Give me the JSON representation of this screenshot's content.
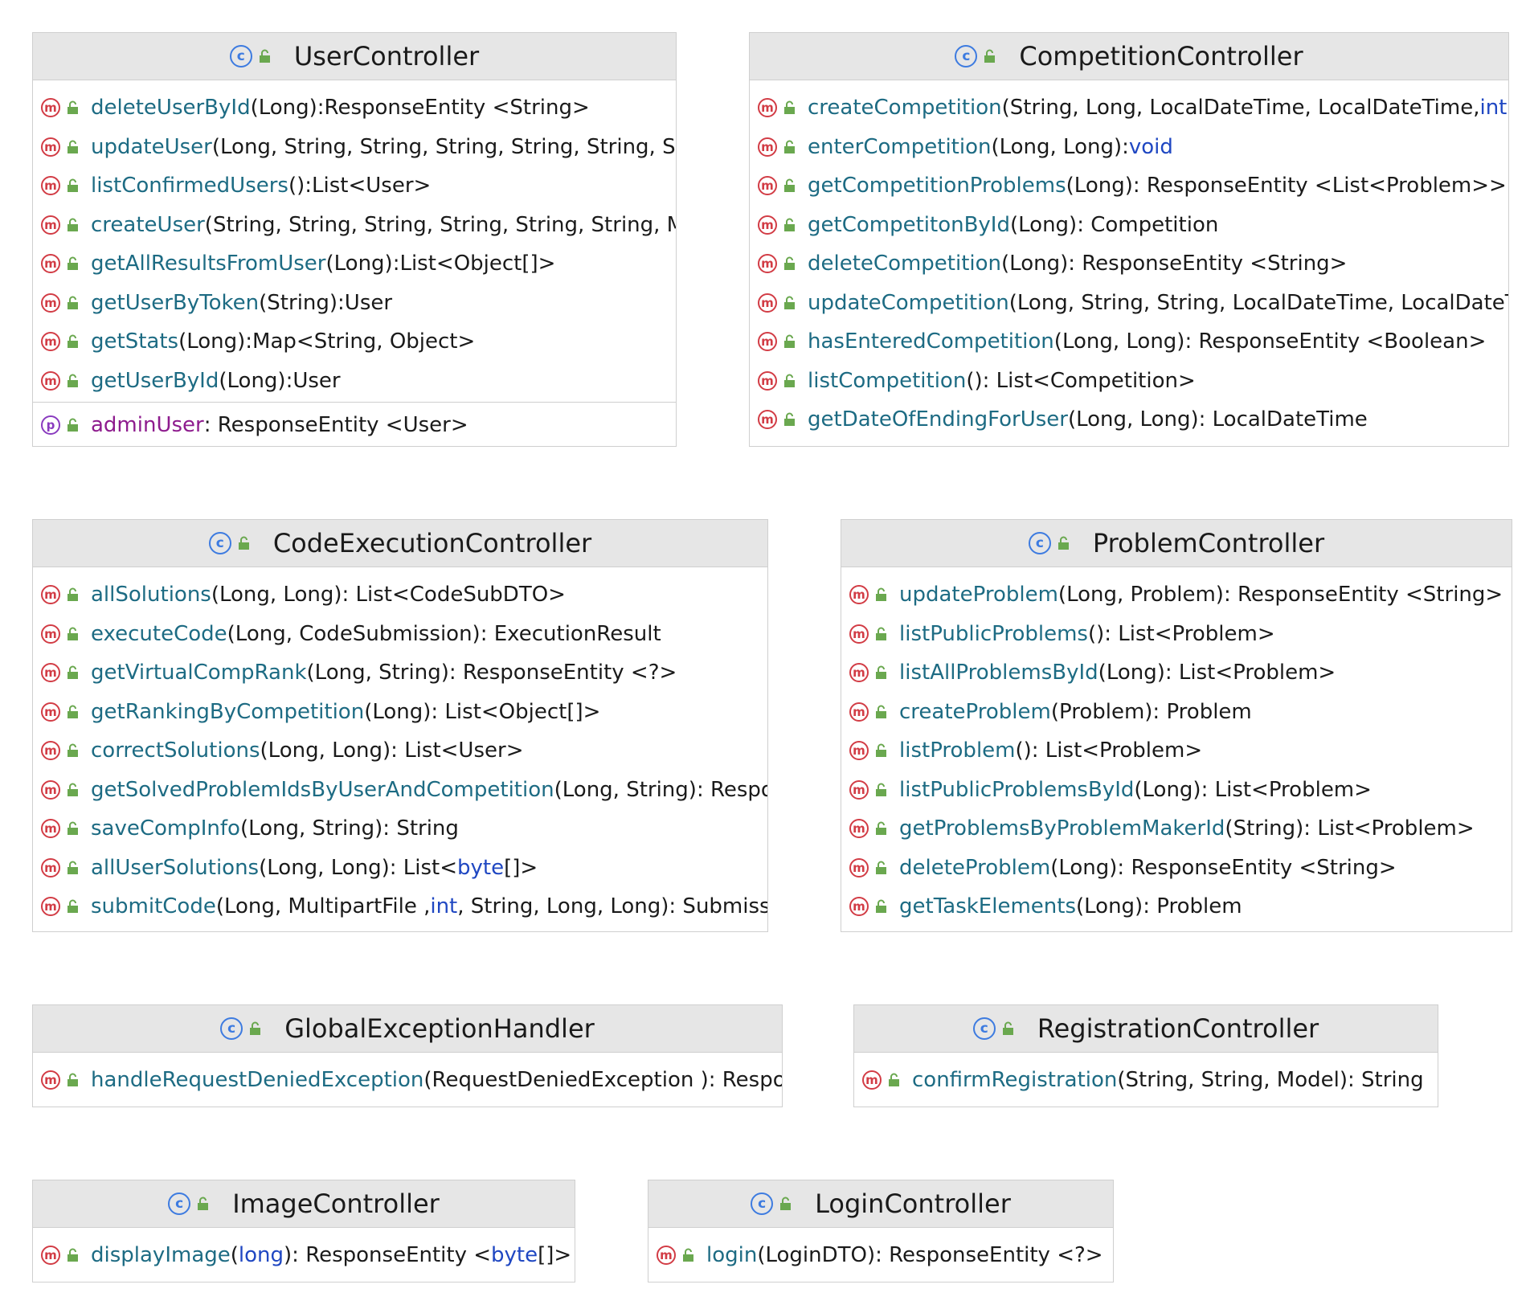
{
  "classes": {
    "user": {
      "name": "UserController",
      "methods": [
        {
          "name": "deleteUserById",
          "params": " (Long):  ",
          "ret": "ResponseEntity <String>"
        },
        {
          "name": "updateUser",
          "params": " (Long, String, String, String, String, String, String",
          "ret": ""
        },
        {
          "name": "listConfirmedUsers",
          "params": " ():  ",
          "ret": "List<User>"
        },
        {
          "name": "createUser",
          "params": " (String, String, String, String, String, String, M",
          "ret": ""
        },
        {
          "name": "getAllResultsFromUser",
          "params": " (Long):  ",
          "ret": "List<Object[]>"
        },
        {
          "name": "getUserByToken",
          "params": " (String):  ",
          "ret": "User"
        },
        {
          "name": "getStats",
          "params": " (Long):  ",
          "ret": "Map<String, Object>"
        },
        {
          "name": "getUserById",
          "params": " (Long):  ",
          "ret": "User"
        }
      ],
      "property": {
        "name": "adminUser",
        "ret": ":  ResponseEntity <User>"
      }
    },
    "competition": {
      "name": "CompetitionController",
      "methods": [
        {
          "name": "createCompetition",
          "params": " (String, Long, LocalDateTime, LocalDateTime, ",
          "kw": "int",
          "tail": ","
        },
        {
          "name": "enterCompetition",
          "params": " (Long, Long):  ",
          "kw": "void",
          "tail": ""
        },
        {
          "name": "getCompetitionProblems",
          "params": " (Long):  ResponseEntity <List<Problem>>",
          "kw": "",
          "tail": ""
        },
        {
          "name": "getCompetitonById",
          "params": " (Long):  Competition",
          "kw": "",
          "tail": ""
        },
        {
          "name": "deleteCompetition",
          "params": " (Long):  ResponseEntity <String>",
          "kw": "",
          "tail": ""
        },
        {
          "name": "updateCompetition",
          "params": " (Long, String, String, LocalDateTime, LocalDateTi",
          "kw": "",
          "tail": ""
        },
        {
          "name": "hasEnteredCompetition",
          "params": " (Long, Long):  ResponseEntity <Boolean>",
          "kw": "",
          "tail": ""
        },
        {
          "name": "listCompetition",
          "params": " ():  List<Competition>",
          "kw": "",
          "tail": ""
        },
        {
          "name": "getDateOfEndingForUser",
          "params": " (Long, Long):  LocalDateTime",
          "kw": "",
          "tail": ""
        }
      ]
    },
    "codeexec": {
      "name": "CodeExecutionController",
      "methods": [
        {
          "name": "allSolutions",
          "params": "(Long, Long):  List<CodeSubDTO>",
          "kw": "",
          "tail": ""
        },
        {
          "name": "executeCode",
          "params": " (Long, CodeSubmission):  ExecutionResult",
          "kw": "",
          "tail": ""
        },
        {
          "name": "getVirtualCompRank",
          "params": "(Long, String):  ResponseEntity <?>",
          "kw": "",
          "tail": ""
        },
        {
          "name": "getRankingByCompetition",
          "params": " (Long):  List<Object[]>",
          "kw": "",
          "tail": ""
        },
        {
          "name": "correctSolutions",
          "params": " (Long, Long):  List<User>",
          "kw": "",
          "tail": ""
        },
        {
          "name": "getSolvedProblemIdsByUserAndCompetition",
          "params": " (Long, String):  Respo",
          "kw": "",
          "tail": ""
        },
        {
          "name": "saveCompInfo",
          "params": "(Long, String):  String",
          "kw": "",
          "tail": ""
        },
        {
          "name": "allUserSolutions",
          "params": " (Long, Long):  List<",
          "kw": "byte",
          "tail": "[]>"
        },
        {
          "name": "submitCode",
          "params": "(Long, MultipartFile , ",
          "kw": "int",
          "tail": ", String, Long, Long):  Submiss"
        }
      ]
    },
    "problem": {
      "name": "ProblemController",
      "methods": [
        {
          "name": "updateProblem",
          "params": "(Long, Problem):  ResponseEntity <String>"
        },
        {
          "name": "listPublicProblems",
          "params": "():  List<Problem>"
        },
        {
          "name": "listAllProblemsById",
          "params": "(Long):  List<Problem>"
        },
        {
          "name": "createProblem",
          "params": "(Problem):  Problem"
        },
        {
          "name": "listProblem",
          "params": "():  List<Problem>"
        },
        {
          "name": "listPublicProblemsById",
          "params": "(Long):  List<Problem>"
        },
        {
          "name": "getProblemsByProblemMakerId",
          "params": "(String):  List<Problem>"
        },
        {
          "name": "deleteProblem",
          "params": " (Long):  ResponseEntity <String>"
        },
        {
          "name": "getTaskElements",
          "params": " (Long):  Problem"
        }
      ]
    },
    "globalex": {
      "name": "GlobalExceptionHandler",
      "methods": [
        {
          "name": "handleRequestDeniedException",
          "params": " (RequestDeniedException ):  Respor"
        }
      ]
    },
    "registration": {
      "name": "RegistrationController",
      "methods": [
        {
          "name": "confirmRegistration",
          "params": " (String, String, Model):  String"
        }
      ]
    },
    "image": {
      "name": "ImageController",
      "methods": [
        {
          "name": "displayImage",
          "params": "(",
          "kw": "long",
          "tail": "):  ResponseEntity <",
          "kw2": "byte",
          "tail2": "[]>"
        }
      ]
    },
    "login": {
      "name": "LoginController",
      "methods": [
        {
          "name": "login",
          "params": "(LoginDTO):  ResponseEntity <?>"
        }
      ]
    }
  },
  "badges": {
    "class": "c",
    "method": "m",
    "property": "p"
  },
  "colors": {
    "method_name": "#1d6b83",
    "property_name": "#8e1c8e",
    "keyword": "#1f47c2",
    "method_badge": "#d23c45",
    "property_badge": "#8a3bbf",
    "class_badge": "#3d7be0",
    "header_bg": "#e6e6e6"
  }
}
